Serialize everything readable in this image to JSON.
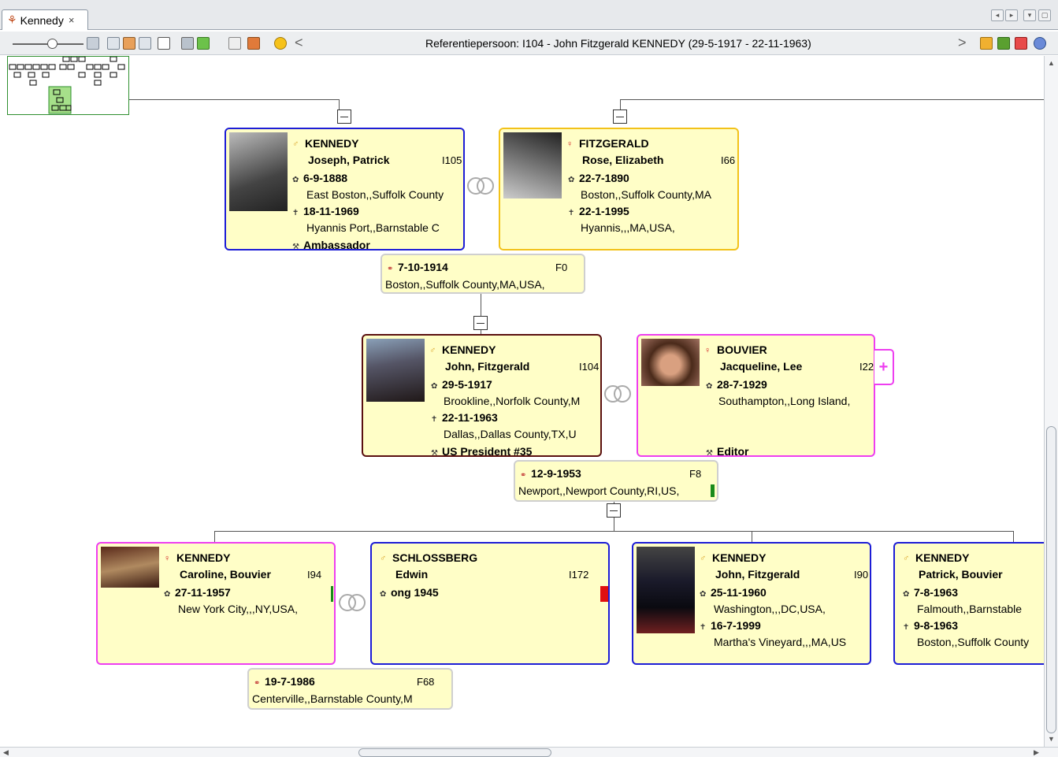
{
  "tab": {
    "title": "Kennedy",
    "close": "×"
  },
  "toolbar": {
    "reference_label": "Referentiepersoon: I104 - John Fitzgerald KENNEDY (29-5-1917 - 22-11-1963)",
    "back": "<",
    "forward": ">"
  },
  "colors": {
    "male_border": "#1d1dd6",
    "female_border": "#f2c21a",
    "female_child_border": "#ee3ef0",
    "ref_border": "#5a1010",
    "card_bg": "#fffec7"
  },
  "persons": {
    "joseph": {
      "lastname": "KENNEDY",
      "firstname": "Joseph, Patrick",
      "id": "I105",
      "birth_date": "6-9-1888",
      "birth_place": "East Boston,,Suffolk County",
      "death_date": "18-11-1969",
      "death_place": "Hyannis Port,,Barnstable C",
      "occupation": "Ambassador"
    },
    "rose": {
      "lastname": "FITZGERALD",
      "firstname": "Rose, Elizabeth",
      "id": "I66",
      "birth_date": "22-7-1890",
      "birth_place": "Boston,,Suffolk County,MA",
      "death_date": "22-1-1995",
      "death_place": "Hyannis,,,MA,USA,"
    },
    "john": {
      "lastname": "KENNEDY",
      "firstname": "John, Fitzgerald",
      "id": "I104",
      "birth_date": "29-5-1917",
      "birth_place": "Brookline,,Norfolk County,M",
      "death_date": "22-11-1963",
      "death_place": "Dallas,,Dallas County,TX,U",
      "occupation": "US President #35"
    },
    "jacqueline": {
      "lastname": "BOUVIER",
      "firstname": "Jacqueline, Lee",
      "id": "I22",
      "birth_date": "28-7-1929",
      "birth_place": "Southampton,,Long Island,",
      "occupation": "Editor",
      "expand": "+"
    },
    "caroline": {
      "lastname": "KENNEDY",
      "firstname": "Caroline, Bouvier",
      "id": "I94",
      "birth_date": "27-11-1957",
      "birth_place": "New York City,,,NY,USA,"
    },
    "edwin": {
      "lastname": "SCHLOSSBERG",
      "firstname": "Edwin",
      "id": "I172",
      "birth_date": "ong 1945"
    },
    "johnjr": {
      "lastname": "KENNEDY",
      "firstname": "John, Fitzgerald",
      "id": "I90",
      "birth_date": "25-11-1960",
      "birth_place": "Washington,,,DC,USA,",
      "death_date": "16-7-1999",
      "death_place": "Martha's Vineyard,,,MA,US"
    },
    "patrick": {
      "lastname": "KENNEDY",
      "firstname": "Patrick, Bouvier",
      "birth_date": "7-8-1963",
      "birth_place": "Falmouth,,Barnstable",
      "death_date": "9-8-1963",
      "death_place": "Boston,,Suffolk County"
    }
  },
  "families": {
    "f0": {
      "date": "7-10-1914",
      "id": "F0",
      "place": "Boston,,Suffolk County,MA,USA,"
    },
    "f8": {
      "date": "12-9-1953",
      "id": "F8",
      "place": "Newport,,Newport County,RI,US,"
    },
    "f68": {
      "date": "19-7-1986",
      "id": "F68",
      "place": "Centerville,,Barnstable County,M"
    }
  }
}
